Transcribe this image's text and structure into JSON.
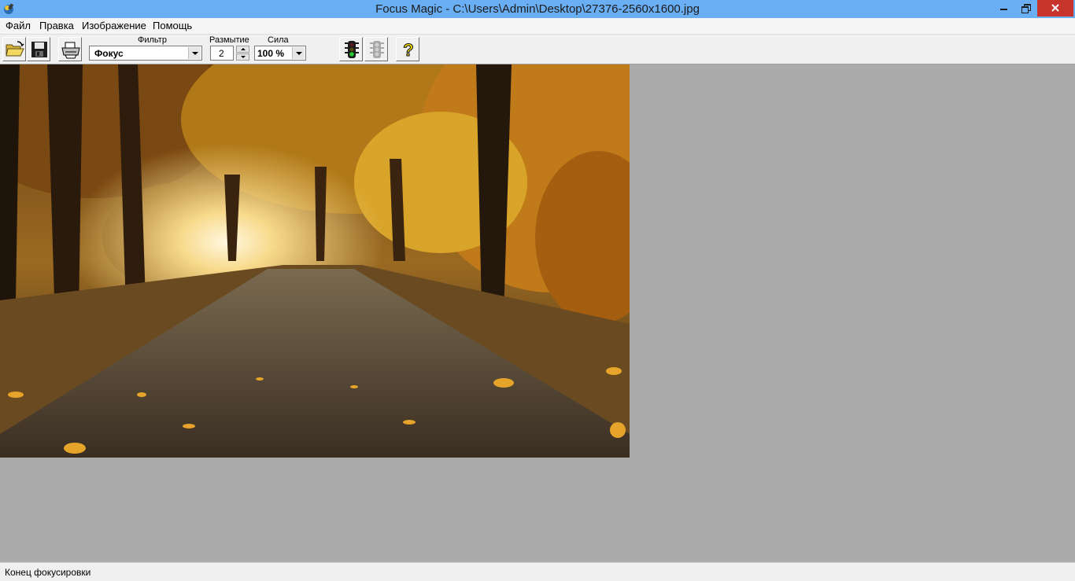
{
  "window": {
    "title": "Focus Magic - C:\\Users\\Admin\\Desktop\\27376-2560x1600.jpg",
    "accent_color": "#6aaef3",
    "close_color": "#c7342b"
  },
  "menu": {
    "items": [
      {
        "label": "Файл"
      },
      {
        "label": "Правка"
      },
      {
        "label": "Изображение"
      },
      {
        "label": "Помощь"
      }
    ]
  },
  "toolbar": {
    "filter_label": "Фильтр",
    "filter_value": "Фокус",
    "blur_label": "Размытие",
    "blur_value": "2",
    "strength_label": "Сила",
    "strength_value": "100 %",
    "buttons": [
      "open-icon",
      "save-icon",
      "print-icon",
      "traffic-light-icon",
      "traffic-light-disabled-icon",
      "help-icon"
    ]
  },
  "image": {
    "description_icon": "autumn-forest-road-photo"
  },
  "status": {
    "text": "Конец фокусировки"
  }
}
